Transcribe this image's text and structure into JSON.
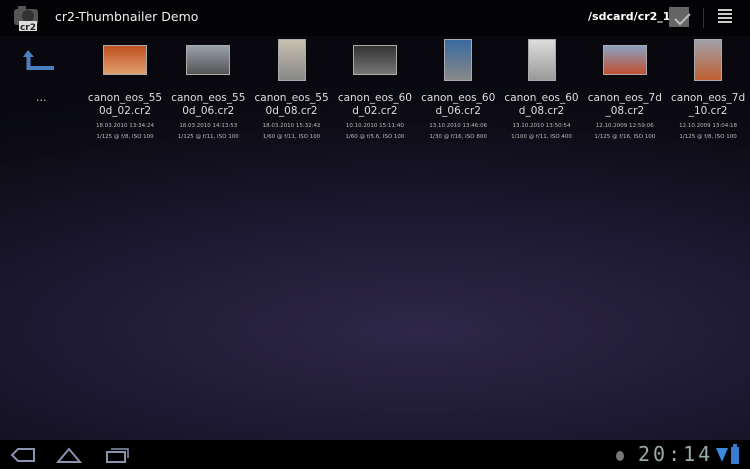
{
  "app": {
    "title": "cr2-Thumbnailer Demo",
    "logo_text": "cr2",
    "path": "/sdcard/cr2_1"
  },
  "up": {
    "label": "..."
  },
  "files": [
    {
      "name": "canon_eos_550d_02.cr2",
      "date": "18.03.2010 13:34:24",
      "exposure": "1/125 @ f/8, ISO 100",
      "colors": [
        "#c05020",
        "#e0a070"
      ],
      "orient": "land"
    },
    {
      "name": "canon_eos_550d_06.cr2",
      "date": "18.03.2010 14:13:53",
      "exposure": "1/125 @ f/11, ISO 100",
      "colors": [
        "#9aa0a8",
        "#555"
      ],
      "orient": "land"
    },
    {
      "name": "canon_eos_550d_08.cr2",
      "date": "18.03.2010 15:32:42",
      "exposure": "1/60 @ f/11, ISO 100",
      "colors": [
        "#c8c0b0",
        "#888"
      ],
      "orient": "port"
    },
    {
      "name": "canon_eos_60d_02.cr2",
      "date": "10.10.2010 15:11:40",
      "exposure": "1/60 @ f/5.6, ISO 100",
      "colors": [
        "#333",
        "#777"
      ],
      "orient": "land"
    },
    {
      "name": "canon_eos_60d_06.cr2",
      "date": "13.10.2010 13:46:06",
      "exposure": "1/30 @ f/16, ISO 800",
      "colors": [
        "#3a6aa0",
        "#888"
      ],
      "orient": "port"
    },
    {
      "name": "canon_eos_60d_08.cr2",
      "date": "13.10.2010 13:50:54",
      "exposure": "1/100 @ f/11, ISO 400",
      "colors": [
        "#ddd",
        "#999"
      ],
      "orient": "port"
    },
    {
      "name": "canon_eos_7d_08.cr2",
      "date": "12.10.2009 12:59:06",
      "exposure": "1/125 @ f/16, ISO 100",
      "colors": [
        "#8aa0c0",
        "#c05030"
      ],
      "orient": "land"
    },
    {
      "name": "canon_eos_7d_10.cr2",
      "date": "12.10.2009 13:04:18",
      "exposure": "1/125 @ f/8, ISO 100",
      "colors": [
        "#a0a0a8",
        "#c06030"
      ],
      "orient": "port"
    }
  ],
  "status": {
    "time": "20:14"
  }
}
